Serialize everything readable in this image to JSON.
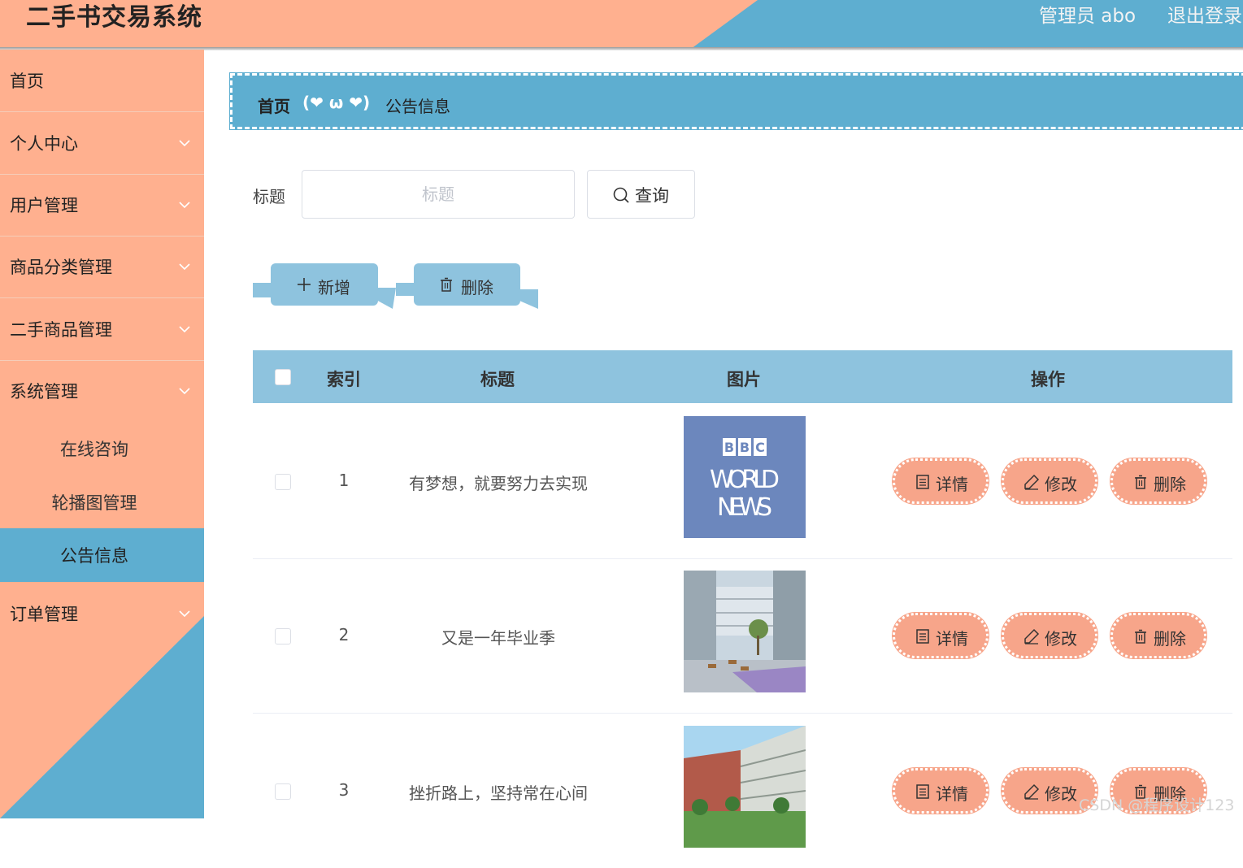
{
  "header": {
    "title": "二手书交易系统",
    "user_info": "管理员 abo",
    "logout": "退出登录"
  },
  "sidebar": {
    "items": [
      {
        "label": "首页"
      },
      {
        "label": "个人中心"
      },
      {
        "label": "用户管理"
      },
      {
        "label": "商品分类管理"
      },
      {
        "label": "二手商品管理"
      },
      {
        "label": "系统管理"
      },
      {
        "label": "订单管理"
      }
    ],
    "sub_items": [
      {
        "label": "在线咨询"
      },
      {
        "label": "轮播图管理"
      },
      {
        "label": "公告信息"
      }
    ]
  },
  "breadcrumb": {
    "home": "首页",
    "separator": "(❤ ω ❤)",
    "current": "公告信息"
  },
  "search": {
    "label": "标题",
    "placeholder": "标题",
    "button": "查询"
  },
  "actions": {
    "add": "新增",
    "delete": "删除"
  },
  "table": {
    "headers": {
      "index": "索引",
      "title": "标题",
      "image": "图片",
      "operation": "操作"
    },
    "rows": [
      {
        "index": "1",
        "title": "有梦想，就要努力去实现",
        "image": "bbc-world-news"
      },
      {
        "index": "2",
        "title": "又是一年毕业季",
        "image": "campus-courtyard"
      },
      {
        "index": "3",
        "title": "挫折路上，坚持常在心间",
        "image": "campus-building"
      }
    ],
    "ops": {
      "detail": "详情",
      "edit": "修改",
      "delete": "删除"
    }
  },
  "thumb_text": {
    "bbc": "BBC",
    "world": "WORLD",
    "news": "NEWS"
  },
  "watermark": "CSDN @程序设计123",
  "colors": {
    "salmon": "#ffb08f",
    "blue": "#5eaed0",
    "light_blue": "#8ec3de",
    "op_btn": "#f7a58a"
  }
}
